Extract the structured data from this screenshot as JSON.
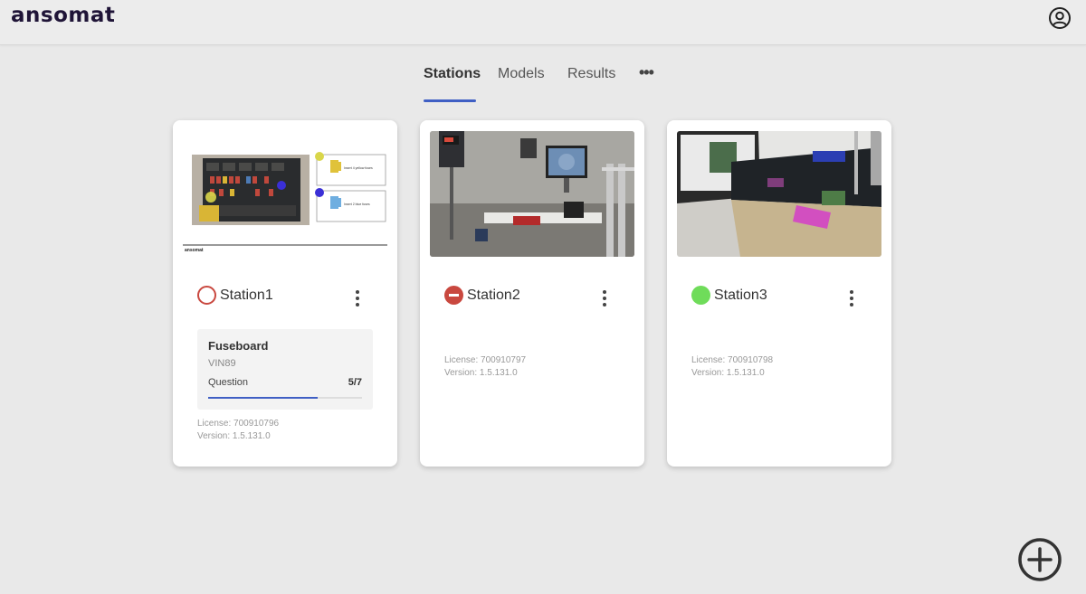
{
  "app": {
    "logo": "ansomat"
  },
  "tabs": [
    {
      "label": "Stations",
      "active": true
    },
    {
      "label": "Models",
      "active": false
    },
    {
      "label": "Results",
      "active": false
    }
  ],
  "tab_more": "•••",
  "colors": {
    "accent": "#3f5fc4",
    "status_error": "#c9483f",
    "status_ok": "#6fdc5a"
  },
  "stations": [
    {
      "name": "Station1",
      "status": "off",
      "job": {
        "title": "Fuseboard",
        "vin": "VIN89",
        "question_label": "Question",
        "progress_text": "5/7",
        "progress_fraction": 0.714
      },
      "license_label": "License:",
      "license": "700910796",
      "version_label": "Version:",
      "version": "1.5.131.0",
      "thumb": {
        "step1": "Insert 4 yellow fuses",
        "step2": "Insert 2 blue fuses",
        "footer": "ansomat"
      }
    },
    {
      "name": "Station2",
      "status": "busy",
      "license_label": "License:",
      "license": "700910797",
      "version_label": "Version:",
      "version": "1.5.131.0"
    },
    {
      "name": "Station3",
      "status": "ok",
      "license_label": "License:",
      "license": "700910798",
      "version_label": "Version:",
      "version": "1.5.131.0"
    }
  ]
}
